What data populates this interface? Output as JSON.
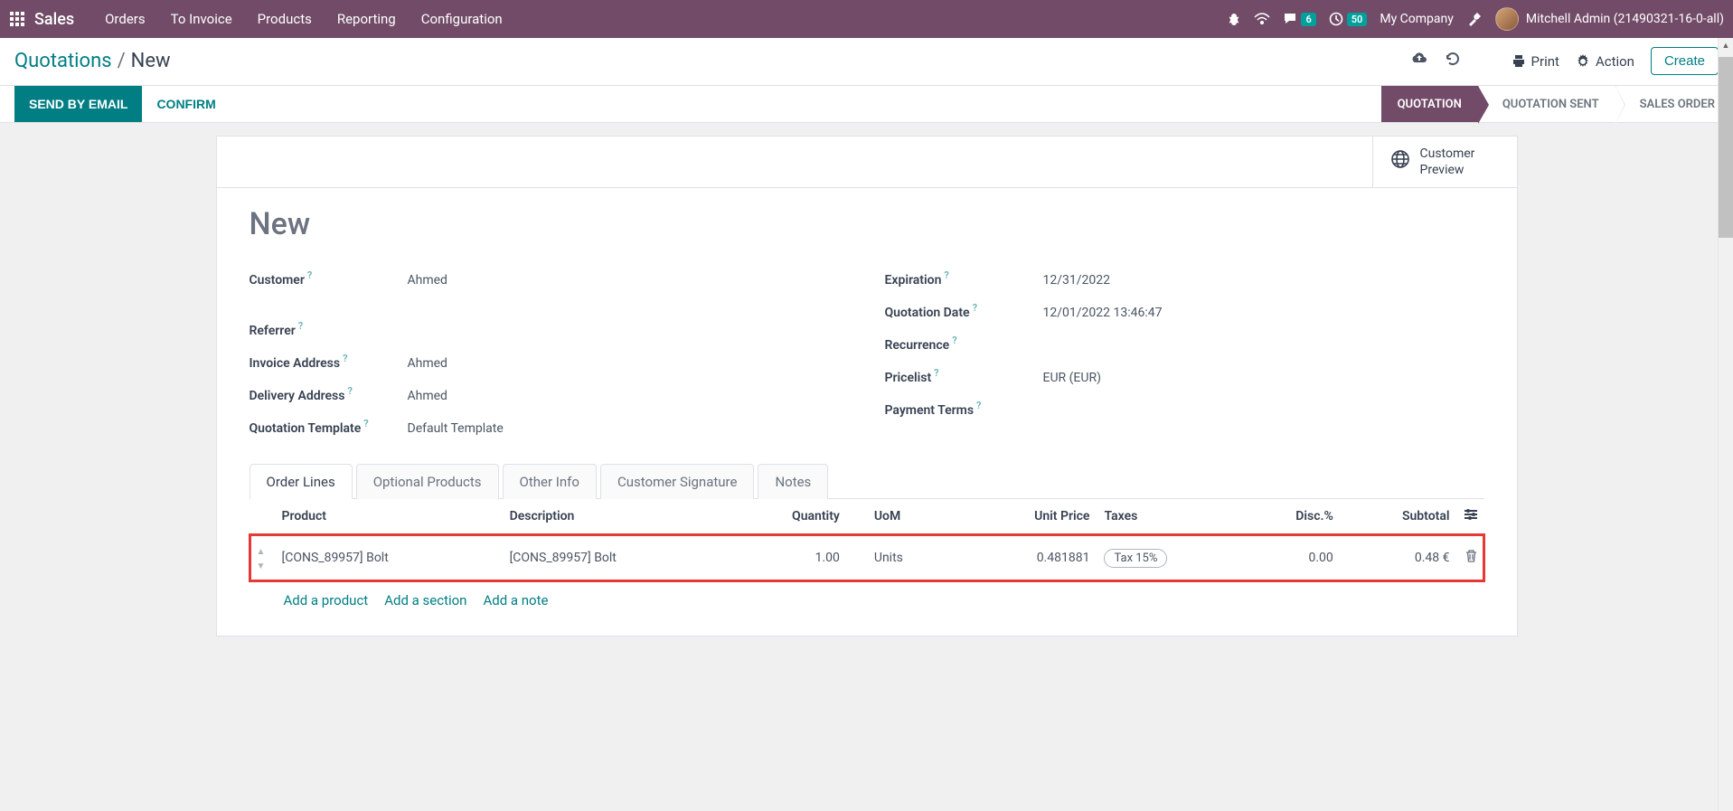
{
  "topbar": {
    "app_name": "Sales",
    "nav": [
      "Orders",
      "To Invoice",
      "Products",
      "Reporting",
      "Configuration"
    ],
    "chat_badge": "6",
    "clock_badge": "50",
    "company": "My Company",
    "user": "Mitchell Admin (21490321-16-0-all)"
  },
  "breadcrumb": {
    "root": "Quotations",
    "current": "New"
  },
  "controls": {
    "print": "Print",
    "action": "Action",
    "create": "Create"
  },
  "actions": {
    "send_email": "SEND BY EMAIL",
    "confirm": "CONFIRM"
  },
  "status_steps": [
    "QUOTATION",
    "QUOTATION SENT",
    "SALES ORDER"
  ],
  "stat_button": {
    "line1": "Customer",
    "line2": "Preview"
  },
  "record": {
    "title": "New",
    "left": {
      "customer": {
        "label": "Customer",
        "value": "Ahmed"
      },
      "referrer": {
        "label": "Referrer",
        "value": ""
      },
      "invoice_address": {
        "label": "Invoice Address",
        "value": "Ahmed"
      },
      "delivery_address": {
        "label": "Delivery Address",
        "value": "Ahmed"
      },
      "quotation_template": {
        "label": "Quotation Template",
        "value": "Default Template"
      }
    },
    "right": {
      "expiration": {
        "label": "Expiration",
        "value": "12/31/2022"
      },
      "quotation_date": {
        "label": "Quotation Date",
        "value": "12/01/2022 13:46:47"
      },
      "recurrence": {
        "label": "Recurrence",
        "value": ""
      },
      "pricelist": {
        "label": "Pricelist",
        "value": "EUR (EUR)"
      },
      "payment_terms": {
        "label": "Payment Terms",
        "value": ""
      }
    }
  },
  "tabs": [
    "Order Lines",
    "Optional Products",
    "Other Info",
    "Customer Signature",
    "Notes"
  ],
  "table": {
    "headers": {
      "product": "Product",
      "description": "Description",
      "quantity": "Quantity",
      "uom": "UoM",
      "unit_price": "Unit Price",
      "taxes": "Taxes",
      "disc": "Disc.%",
      "subtotal": "Subtotal"
    },
    "row": {
      "product": "[CONS_89957] Bolt",
      "description": "[CONS_89957] Bolt",
      "quantity": "1.00",
      "uom": "Units",
      "unit_price": "0.481881",
      "tax": "Tax 15%",
      "disc": "0.00",
      "subtotal": "0.48 €"
    },
    "add_links": {
      "product": "Add a product",
      "section": "Add a section",
      "note": "Add a note"
    }
  }
}
